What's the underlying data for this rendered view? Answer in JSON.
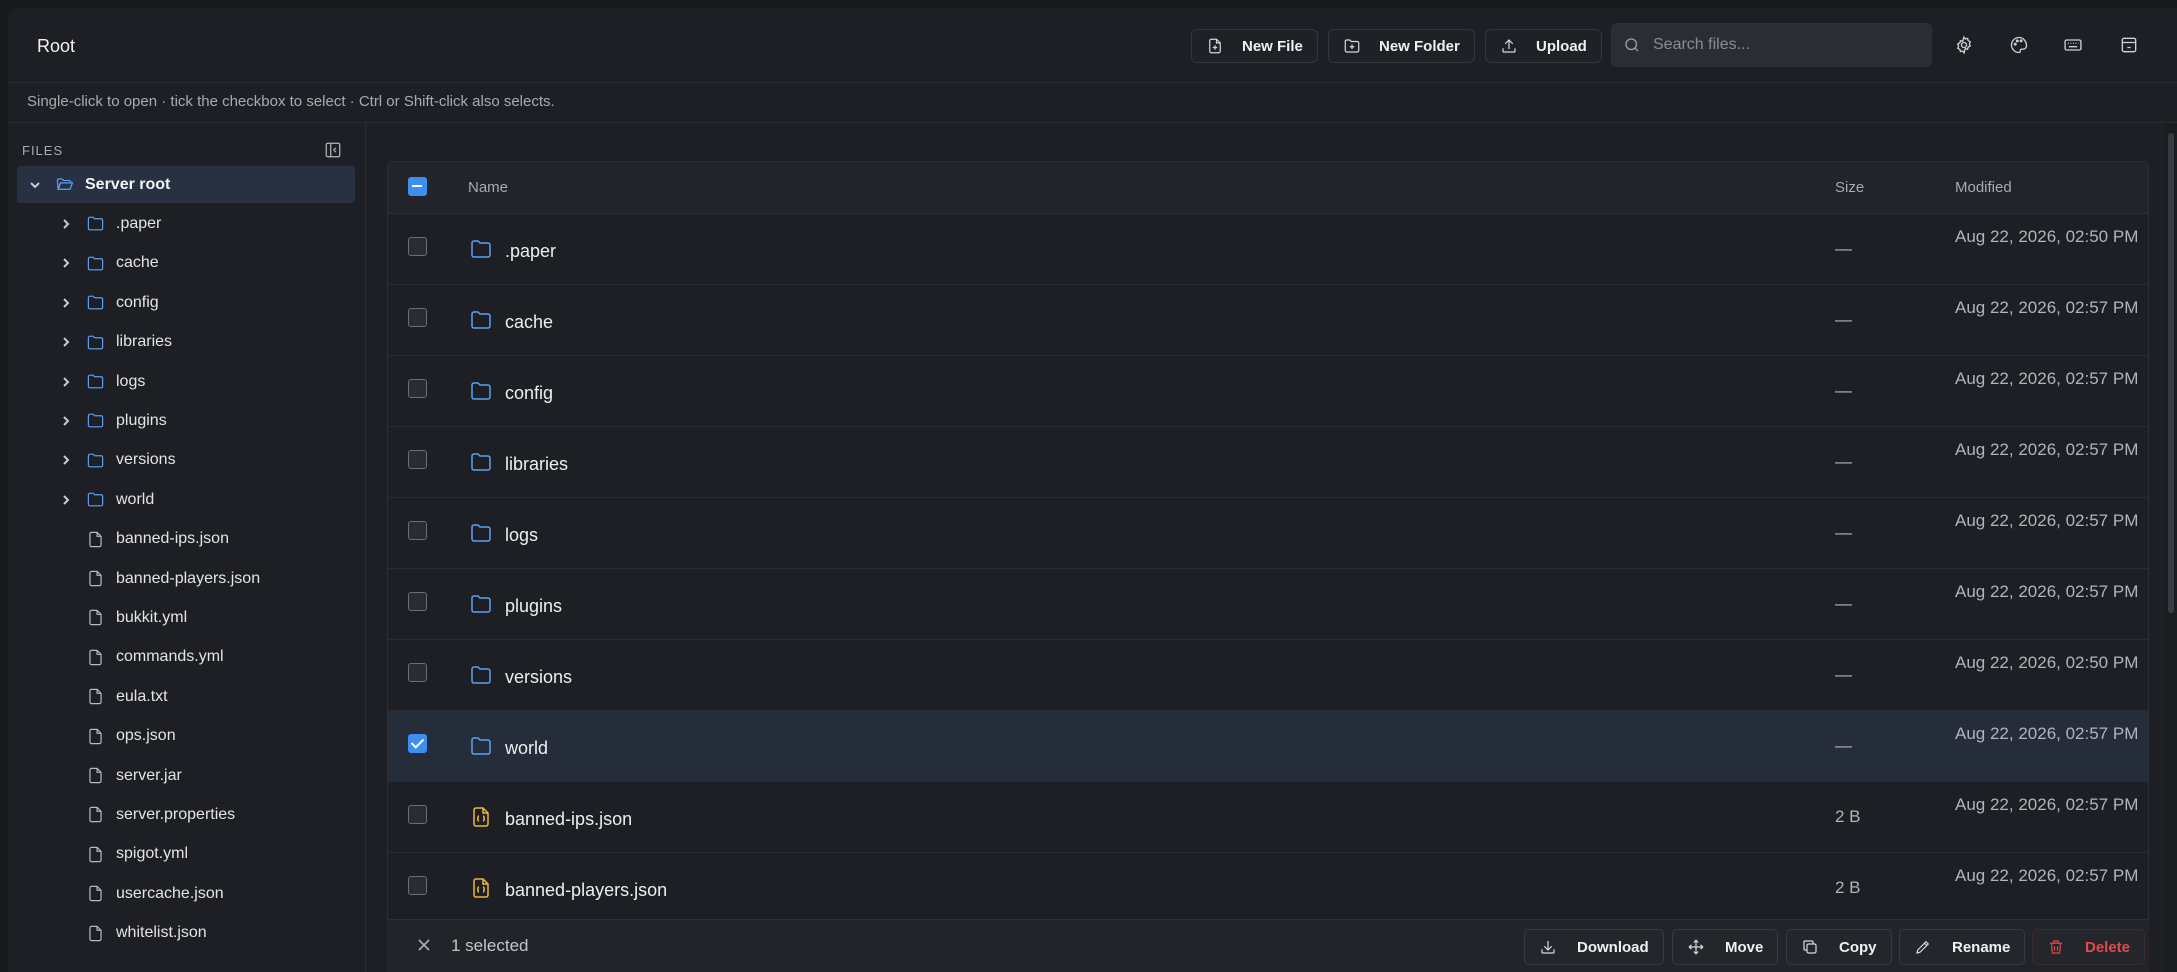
{
  "header": {
    "title": "Root",
    "new_file": "New File",
    "new_folder": "New Folder",
    "upload": "Upload",
    "search_placeholder": "Search files..."
  },
  "hint": "Single-click to open · tick the checkbox to select · Ctrl or Shift-click also selects.",
  "sidebar": {
    "label": "FILES",
    "root": "Server root",
    "folders": [
      ".paper",
      "cache",
      "config",
      "libraries",
      "logs",
      "plugins",
      "versions",
      "world"
    ],
    "files": [
      "banned-ips.json",
      "banned-players.json",
      "bukkit.yml",
      "commands.yml",
      "eula.txt",
      "ops.json",
      "server.jar",
      "server.properties",
      "spigot.yml",
      "usercache.json",
      "whitelist.json"
    ]
  },
  "table": {
    "col_name": "Name",
    "col_size": "Size",
    "col_modified": "Modified",
    "rows": [
      {
        "name": ".paper",
        "type": "folder",
        "size": "—",
        "modified": "Aug 22, 2026, 02:50 PM",
        "checked": false
      },
      {
        "name": "cache",
        "type": "folder",
        "size": "—",
        "modified": "Aug 22, 2026, 02:57 PM",
        "checked": false
      },
      {
        "name": "config",
        "type": "folder",
        "size": "—",
        "modified": "Aug 22, 2026, 02:57 PM",
        "checked": false
      },
      {
        "name": "libraries",
        "type": "folder",
        "size": "—",
        "modified": "Aug 22, 2026, 02:57 PM",
        "checked": false
      },
      {
        "name": "logs",
        "type": "folder",
        "size": "—",
        "modified": "Aug 22, 2026, 02:57 PM",
        "checked": false
      },
      {
        "name": "plugins",
        "type": "folder",
        "size": "—",
        "modified": "Aug 22, 2026, 02:57 PM",
        "checked": false
      },
      {
        "name": "versions",
        "type": "folder",
        "size": "—",
        "modified": "Aug 22, 2026, 02:50 PM",
        "checked": false
      },
      {
        "name": "world",
        "type": "folder",
        "size": "—",
        "modified": "Aug 22, 2026, 02:57 PM",
        "checked": true
      },
      {
        "name": "banned-ips.json",
        "type": "json",
        "size": "2 B",
        "modified": "Aug 22, 2026, 02:57 PM",
        "checked": false
      },
      {
        "name": "banned-players.json",
        "type": "json",
        "size": "2 B",
        "modified": "Aug 22, 2026, 02:57 PM",
        "checked": false
      }
    ]
  },
  "actionbar": {
    "count": "1 selected",
    "download": "Download",
    "move": "Move",
    "copy": "Copy",
    "rename": "Rename",
    "delete": "Delete"
  },
  "colors": {
    "accent": "#3e8ef0",
    "folder": "#5aa3f5",
    "json": "#e8b93b",
    "danger": "#e5484d"
  }
}
